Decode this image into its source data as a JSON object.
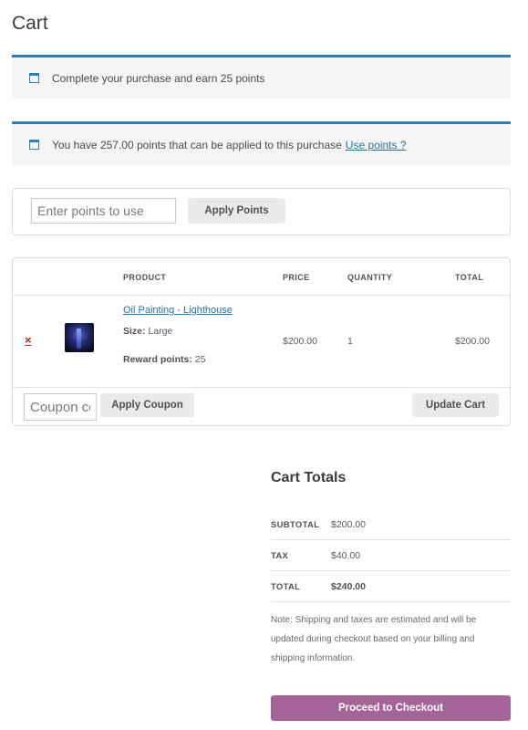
{
  "page": {
    "title": "Cart"
  },
  "notices": {
    "earn_text": "Complete your purchase and earn 25 points",
    "available_text": "You have 257.00 points that can be applied to this purchase",
    "use_points_link": "Use points ?"
  },
  "points": {
    "placeholder": "Enter points to use",
    "apply_label": "Apply Points"
  },
  "table": {
    "headers": {
      "product": "PRODUCT",
      "price": "PRICE",
      "quantity": "QUANTITY",
      "total": "TOTAL"
    },
    "items": [
      {
        "remove_icon": "×",
        "name": "Oil Painting - Lighthouse",
        "size_label": "Size:",
        "size_value": "Large",
        "reward_label": "Reward points:",
        "reward_value": "25",
        "price": "$200.00",
        "quantity": "1",
        "total": "$200.00"
      }
    ],
    "coupon_placeholder": "Coupon code",
    "apply_coupon_label": "Apply Coupon",
    "update_cart_label": "Update Cart"
  },
  "totals": {
    "title": "Cart Totals",
    "subtotal_label": "SUBTOTAL",
    "subtotal_value": "$200.00",
    "tax_label": "TAX",
    "tax_value": "$40.00",
    "total_label": "TOTAL",
    "total_value": "$240.00",
    "note": "Note: Shipping and taxes are estimated and will be updated during checkout based on your billing and shipping information.",
    "checkout_label": "Proceed to Checkout"
  },
  "colors": {
    "accent": "#2e7fb3",
    "checkout": "#a46497",
    "remove": "#c0271f"
  },
  "icons": {
    "notice": "info-window-icon",
    "remove": "remove-x-icon"
  }
}
